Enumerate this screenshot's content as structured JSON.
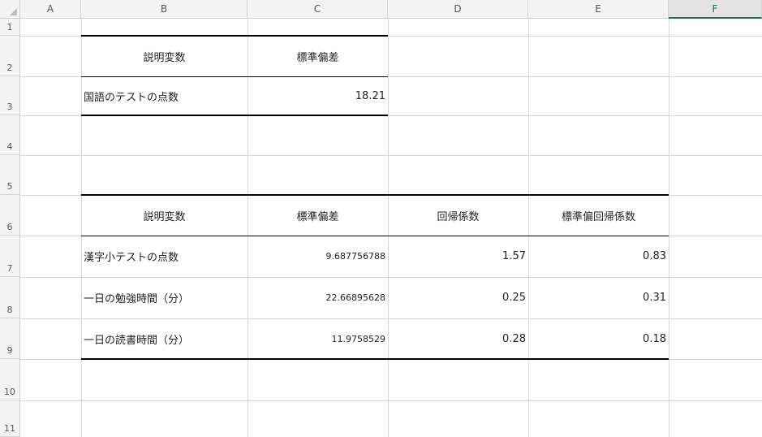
{
  "columns": [
    "A",
    "B",
    "C",
    "D",
    "E",
    "F"
  ],
  "selected_column": "F",
  "rows": [
    "1",
    "2",
    "3",
    "4",
    "5",
    "6",
    "7",
    "8",
    "9",
    "10",
    "11"
  ],
  "table1": {
    "headers": [
      "説明変数",
      "標準偏差"
    ],
    "rows": [
      [
        "国語のテストの点数",
        "18.21"
      ]
    ]
  },
  "table2": {
    "headers": [
      "説明変数",
      "標準偏差",
      "回帰係数",
      "標準偏回帰係数"
    ],
    "rows": [
      [
        "漢字小テストの点数",
        "9.687756788",
        "1.57",
        "0.83"
      ],
      [
        "一日の勉強時間（分）",
        "22.66895628",
        "0.25",
        "0.31"
      ],
      [
        "一日の読書時間（分）",
        "11.9758529",
        "0.28",
        "0.18"
      ]
    ]
  }
}
